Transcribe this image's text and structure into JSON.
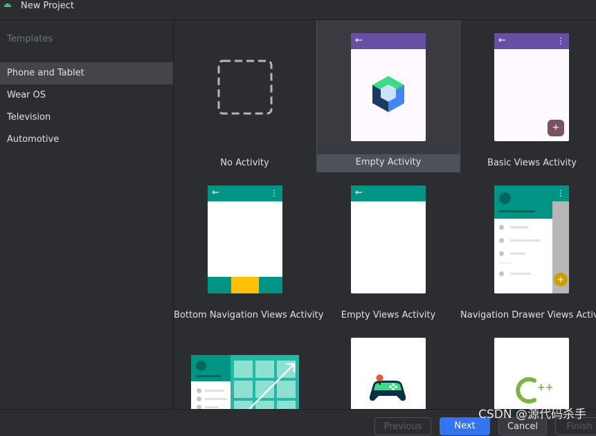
{
  "window": {
    "title": "New Project"
  },
  "sidebar": {
    "header": "Templates",
    "items": [
      {
        "label": "Phone and Tablet",
        "selected": true
      },
      {
        "label": "Wear OS",
        "selected": false
      },
      {
        "label": "Television",
        "selected": false
      },
      {
        "label": "Automotive",
        "selected": false
      }
    ]
  },
  "templates": [
    {
      "label": "No Activity",
      "selected": false
    },
    {
      "label": "Empty Activity",
      "selected": true
    },
    {
      "label": "Basic Views Activity",
      "selected": false
    },
    {
      "label": "Bottom Navigation Views Activity",
      "selected": false
    },
    {
      "label": "Empty Views Activity",
      "selected": false
    },
    {
      "label": "Navigation Drawer Views Activity",
      "selected": false
    },
    {
      "label": "",
      "selected": false
    },
    {
      "label": "",
      "selected": false
    },
    {
      "label": "",
      "selected": false
    }
  ],
  "icons": {
    "back": "←",
    "kebab": "⋮",
    "fab_plus": "+",
    "cpp": "++"
  },
  "colors": {
    "purple": "#6750a4",
    "teal": "#009485",
    "amber": "#ffc107",
    "accent_blue": "#3574f0"
  },
  "footer": {
    "previous": "Previous",
    "next": "Next",
    "cancel": "Cancel",
    "finish": "Finish"
  },
  "watermark": "CSDN @源代码杀手"
}
